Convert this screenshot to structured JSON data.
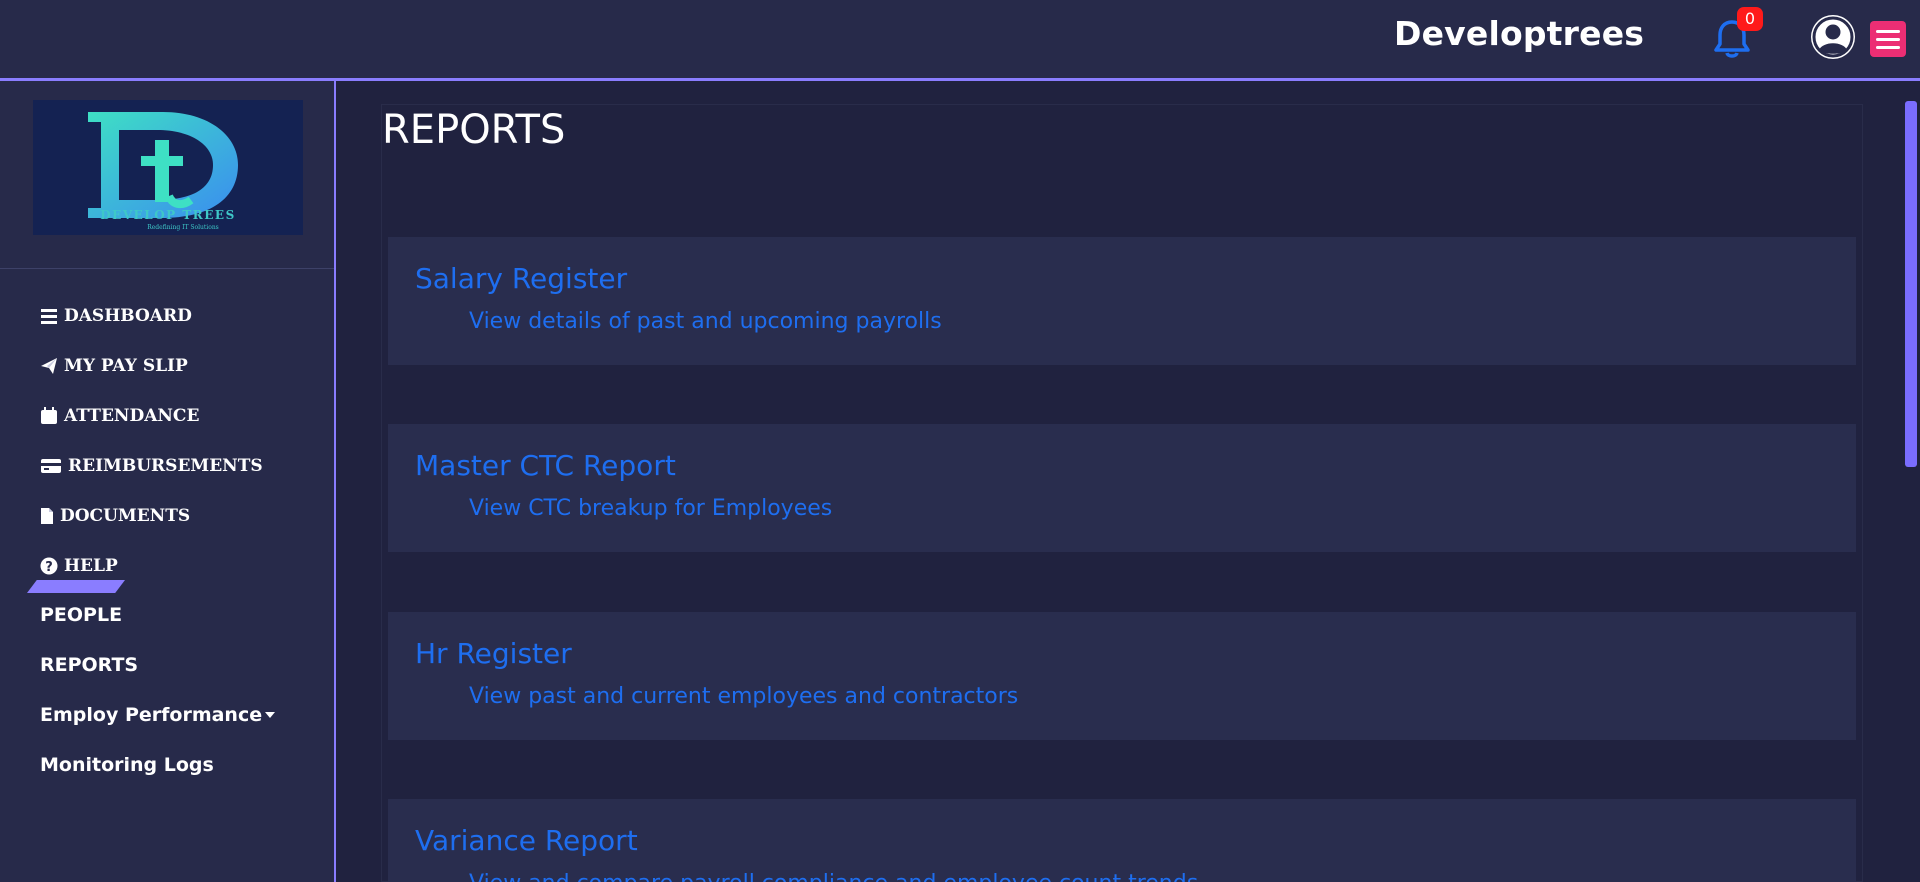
{
  "header": {
    "brand": "Developtrees",
    "notifications_count": "0",
    "accent_color": "#8a7dff",
    "menu_button_color": "#ec2e74"
  },
  "sidebar": {
    "logo": {
      "letters": "Dt",
      "name": "DEVELOP TREES",
      "tagline": "Redefining IT Solutions"
    },
    "items": [
      {
        "label": "DASHBOARD",
        "icon": "bars-icon"
      },
      {
        "label": "MY PAY SLIP",
        "icon": "paper-plane-icon"
      },
      {
        "label": "ATTENDANCE",
        "icon": "calendar-icon"
      },
      {
        "label": "REIMBURSEMENTS",
        "icon": "credit-card-icon"
      },
      {
        "label": "DOCUMENTS",
        "icon": "file-icon"
      },
      {
        "label": "HELP",
        "icon": "question-circle-icon"
      },
      {
        "label": "PEOPLE"
      },
      {
        "label": "REPORTS",
        "active": true
      },
      {
        "label": "Employ Performance",
        "icon": "caret-down-icon"
      },
      {
        "label": "Monitoring Logs"
      }
    ]
  },
  "main": {
    "title": "REPORTS",
    "reports": [
      {
        "title": "Salary Register",
        "description": "View details of past and upcoming payrolls"
      },
      {
        "title": "Master CTC Report",
        "description": "View CTC breakup for Employees"
      },
      {
        "title": "Hr Register",
        "description": "View past and current employees and contractors"
      },
      {
        "title": "Variance Report",
        "description": "View and compare payroll compliance and employee count trends"
      }
    ]
  }
}
